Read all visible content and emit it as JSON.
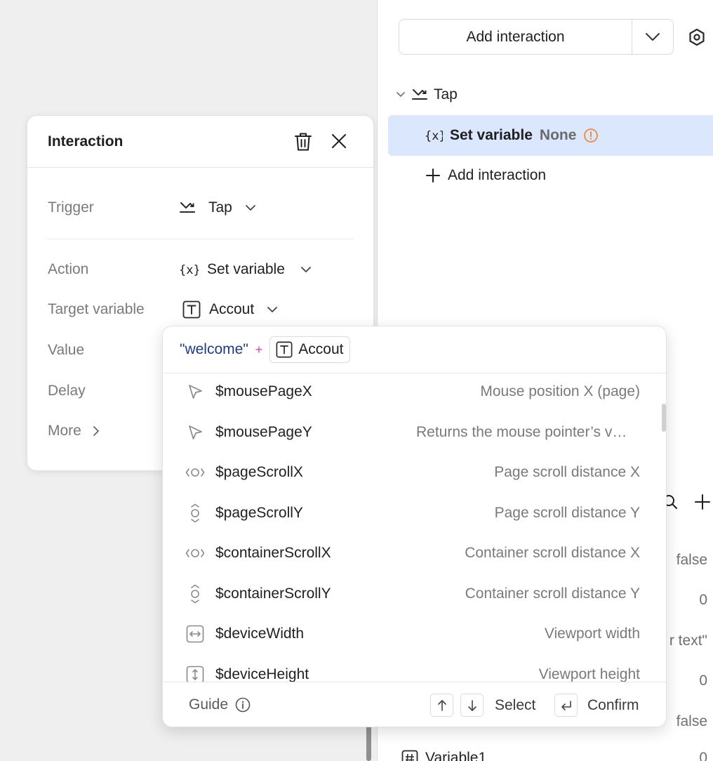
{
  "right_panel": {
    "add_interaction_button": "Add interaction",
    "tree": {
      "trigger_label": "Tap",
      "action_label": "Set variable",
      "action_value": "None",
      "add_interaction_label": "Add interaction"
    },
    "variables": {
      "values": [
        "false",
        "0",
        "r text\"",
        "0",
        "false"
      ],
      "last_row_name": "Variable1",
      "last_row_value": "0"
    }
  },
  "interaction_panel": {
    "title": "Interaction",
    "rows": {
      "trigger": {
        "label": "Trigger",
        "value": "Tap"
      },
      "action": {
        "label": "Action",
        "value": "Set variable"
      },
      "target": {
        "label": "Target variable",
        "value": "Accout"
      },
      "value": {
        "label": "Value"
      },
      "delay": {
        "label": "Delay"
      },
      "more": {
        "label": "More"
      }
    }
  },
  "dropdown": {
    "expression": {
      "string": "\"welcome\"",
      "plus": "+",
      "chip": "Accout"
    },
    "items": [
      {
        "icon": "cursor-icon",
        "name": "$mousePageX",
        "desc": "Mouse position X (page)"
      },
      {
        "icon": "cursor-icon",
        "name": "$mousePageY",
        "desc": "Returns the mouse pointer’s vertical position"
      },
      {
        "icon": "scroll-horizontal-icon",
        "name": "$pageScrollX",
        "desc": "Page scroll distance X"
      },
      {
        "icon": "scroll-vertical-icon",
        "name": "$pageScrollY",
        "desc": "Page scroll distance Y"
      },
      {
        "icon": "scroll-horizontal-icon",
        "name": "$containerScrollX",
        "desc": "Container scroll distance X"
      },
      {
        "icon": "scroll-vertical-icon",
        "name": "$containerScrollY",
        "desc": "Container scroll distance Y"
      },
      {
        "icon": "width-icon",
        "name": "$deviceWidth",
        "desc": "Viewport width"
      },
      {
        "icon": "height-icon",
        "name": "$deviceHeight",
        "desc": "Viewport height"
      }
    ],
    "footer": {
      "guide": "Guide",
      "select": "Select",
      "confirm": "Confirm"
    }
  }
}
